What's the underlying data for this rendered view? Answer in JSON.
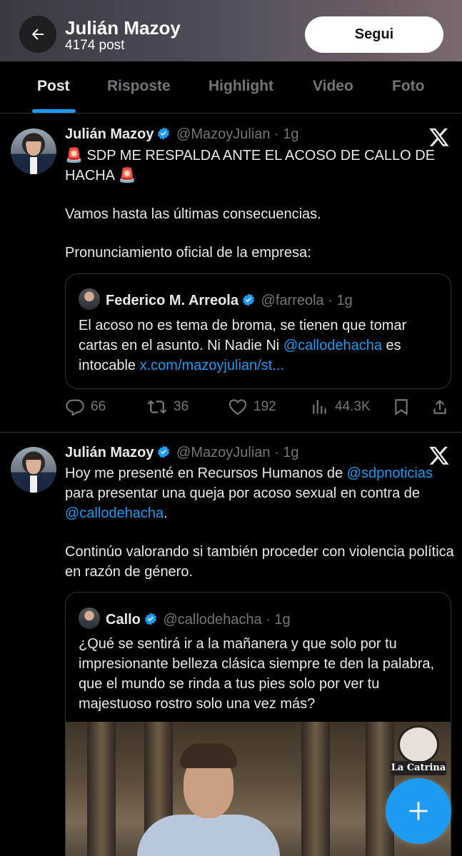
{
  "header": {
    "name": "Julián Mazoy",
    "post_count": "4174 post",
    "follow_label": "Segui"
  },
  "tabs": [
    {
      "label": "Post",
      "active": true
    },
    {
      "label": "Risposte",
      "active": false
    },
    {
      "label": "Highlight",
      "active": false
    },
    {
      "label": "Video",
      "active": false
    },
    {
      "label": "Foto",
      "active": false
    }
  ],
  "posts": [
    {
      "author": "Julián Mazoy",
      "handle": "@MazoyJulian",
      "time": "· 1g",
      "text_line1": "🚨 SDP ME RESPALDA ANTE EL ACOSO DE CALLO DE HACHA 🚨",
      "text_para2": "Vamos hasta las últimas consecuencias.",
      "text_para3": "Pronunciamiento oficial de la empresa:",
      "quote": {
        "author": "Federico M. Arreola",
        "handle": "@farreola",
        "time": "· 1g",
        "text_before": "El acoso no es tema de broma, se tienen que tomar cartas en el asunto. Ni Nadie Ni ",
        "mention": "@callodehacha",
        "text_after": " es intocable ",
        "link": "x.com/mazoyjulian/st..."
      },
      "actions": {
        "replies": "66",
        "reposts": "36",
        "likes": "192",
        "views": "44.3K"
      }
    },
    {
      "author": "Julián Mazoy",
      "handle": "@MazoyJulian",
      "time": "· 1g",
      "text_a": "Hoy me presenté en Recursos Humanos de ",
      "mention1": "@sdpnoticias",
      "text_b": " para presentar una queja por acoso sexual en contra de ",
      "mention2": "@callodehacha",
      "text_c": ".",
      "text_para2": "Continúo valorando si también proceder con violencia política en razón de género.",
      "quote": {
        "author": "Callo",
        "handle": "@callodehacha",
        "time": "· 1g",
        "text": "¿Qué se sentirá ir a la mañanera y que solo por tu impresionante belleza clásica siempre te den la palabra, que el mundo se rinda a tus pies solo por ver tu majestuoso rostro solo una vez más?",
        "media_badge": "La Catrina"
      }
    }
  ],
  "colors": {
    "accent": "#1d9bf0",
    "muted": "#71767b",
    "text": "#e7e9ea",
    "border": "#2f3336"
  }
}
